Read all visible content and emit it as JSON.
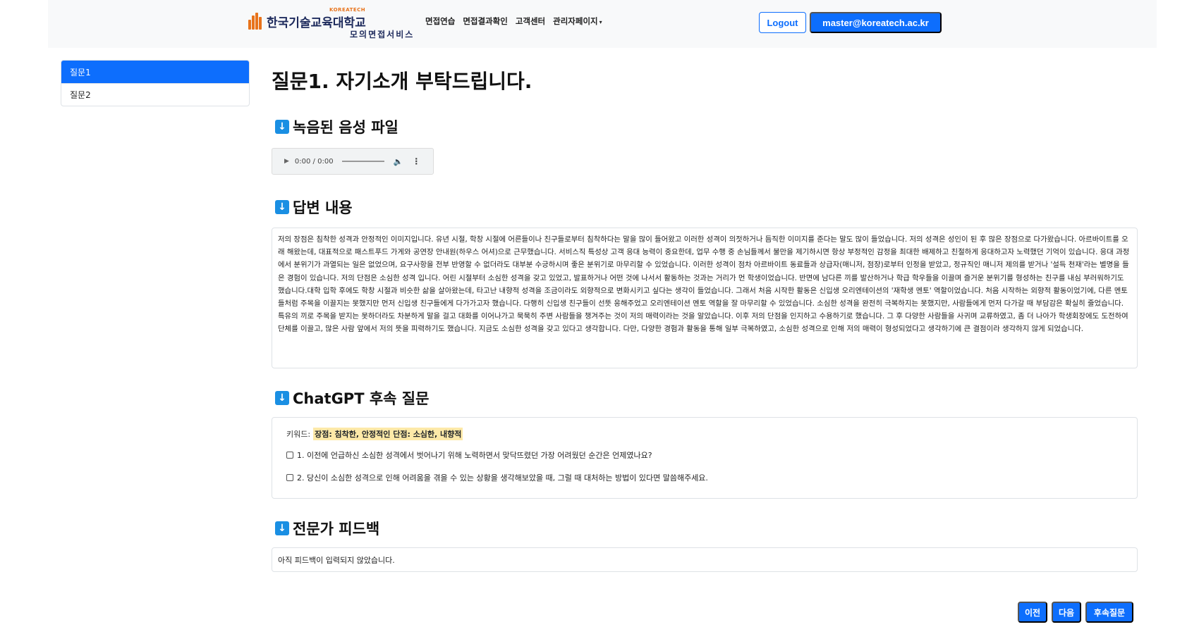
{
  "header": {
    "logo_small": "KOREATECH",
    "logo_main": "한국기술교육대학교",
    "logo_sub": "모의면접서비스",
    "nav": [
      {
        "label": "면접연습"
      },
      {
        "label": "면접결과확인"
      },
      {
        "label": "고객센터"
      },
      {
        "label": "관리자페이지"
      }
    ],
    "logout_label": "Logout",
    "user_label": "master@koreatech.ac.kr"
  },
  "sidebar": {
    "items": [
      {
        "label": "질문1",
        "active": true
      },
      {
        "label": "질문2",
        "active": false
      }
    ]
  },
  "main": {
    "title": "질문1. 자기소개 부탁드립니다.",
    "recording": {
      "heading": "녹음된 음성 파일",
      "time": "0:00 / 0:00"
    },
    "answer": {
      "heading": "답변 내용",
      "text": "저의 장점은 침착한 성격과 안정적인 이미지입니다. 유년 시절, 학창 시절에 어른들이나 친구들로부터 침착하다는 말을 많이 들어왔고 이러한 성격이 의젓하거나 듬직한 이미지를 준다는 말도 많이 들었습니다. 저의 성격은 성인이 된 후 많은 장점으로 다가왔습니다. 아르바이트를 오래 해왔는데, 대표적으로 패스트푸드 가게와 공연장 안내원(하우스 어셔)으로 근무했습니다. 서비스직 특성상 고객 응대 능력이 중요한데, 업무 수행 중 손님들께서 불만을 제기하시면 항상 부정적인 감정을 최대한 배제하고 친절하게 응대하고자 노력했던 기억이 있습니다. 응대 과정에서 분위기가 과열되는 일은 없었으며, 요구사항을 전부 반영할 수 없더라도 대부분 수긍하시며 좋은 분위기로 마무리할 수 있었습니다. 이러한 성격이 점차 아르바이트 동료들과 상급자(매니저, 점장)로부터 인정을 받았고, 정규직인 매니저 제의를 받거나 '설득 천재'라는 별명을 들은 경험이 있습니다. 저의 단점은 소심한 성격 입니다. 어린 시절부터 소심한 성격을 갖고 있었고, 발표하거나 어떤 것에 나서서 활동하는 것과는 거리가 먼 학생이었습니다. 반면에 남다른 끼를 발산하거나 학급 학우들을 이끌며 즐거운 분위기를 형성하는 친구를 내심 부러워하기도 했습니다.대학 입학 후에도 학창 시절과 비슷한 삶을 살아왔는데, 타고난 내향적 성격을 조금이라도 외향적으로 변화시키고 싶다는 생각이 들었습니다. 그래서 처음 시작한 활동은 신입생 오리엔테이션의 '재학생 멘토' 역할이었습니다. 처음 시작하는 외향적 활동이었기에, 다른 멘토들처럼 주목을 이끌지는 못했지만 먼저 신입생 친구들에게 다가가고자 했습니다. 다행히 신입생 친구들이 선뜻 응해주었고 오리엔테이션 멘토 역할을 잘 마무리할 수 있었습니다. 소심한 성격을 완전히 극복하지는 못했지만, 사람들에게 먼저 다가갈 때 부담감은 확실히 줄었습니다. 특유의 끼로 주목을 받지는 못하더라도 차분하게 말을 걸고 대화를 이어나가고 묵묵히 주변 사람들을 챙겨주는 것이 저의 매력이라는 것을 알았습니다. 이후 저의 단점을 인지하고 수용하기로 했습니다. 그 후 다양한 사람들을 사귀며 교류하였고, 좀 더 나아가 학생회장에도 도전하여 단체를 이끌고, 많은 사람 앞에서 저의 뜻을 피력하기도 했습니다. 지금도 소심한 성격을 갖고 있다고 생각합니다. 다만, 다양한 경험과 활동을 통해 일부 극복하였고, 소심한 성격으로 인해 저의 매력이 형성되었다고 생각하기에 큰 결점이라 생각하지 않게 되었습니다."
    },
    "followup": {
      "heading": "ChatGPT 후속 질문",
      "keyword_label": "키워드:",
      "keyword_value": "장점: 침착한, 안정적인 단점: 소심한, 내향적",
      "questions": [
        {
          "text": "1. 이전에 언급하신 소심한 성격에서 벗어나기 위해 노력하면서 맞닥뜨렸던 가장 어려웠던 순간은 언제였나요?"
        },
        {
          "text": "2. 당신이 소심한 성격으로 인해 어려움을 겪을 수 있는 상황을 생각해보았을 때, 그럴 때 대처하는 방법이 있다면 말씀해주세요."
        }
      ]
    },
    "feedback": {
      "heading": "전문가 피드백",
      "text": "아직 피드백이 입력되지 않았습니다."
    }
  },
  "footer": {
    "prev_label": "이전",
    "next_label": "다음",
    "followup_label": "후속질문"
  },
  "colors": {
    "primary": "#0d6efd",
    "icon": "#1a8fe3",
    "highlight": "#fde9a8",
    "logo_orange": "#e8731b",
    "logo_navy": "#1d2a5c"
  }
}
